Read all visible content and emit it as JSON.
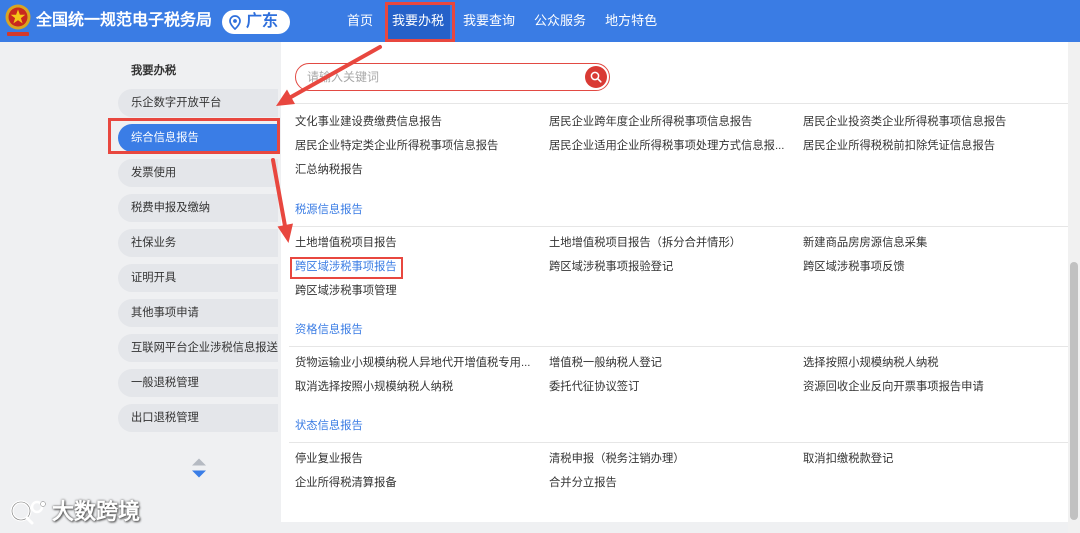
{
  "header": {
    "title": "全国统一规范电子税务局",
    "location": "广东",
    "nav": [
      {
        "label": "首页",
        "active": false
      },
      {
        "label": "我要办税",
        "active": true
      },
      {
        "label": "我要查询",
        "active": false
      },
      {
        "label": "公众服务",
        "active": false
      },
      {
        "label": "地方特色",
        "active": false
      }
    ]
  },
  "sidebar": {
    "heading": "我要办税",
    "selected_index": 1,
    "items": [
      "乐企数字开放平台",
      "综合信息报告",
      "发票使用",
      "税费申报及缴纳",
      "社保业务",
      "证明开具",
      "其他事项申请",
      "互联网平台企业涉税信息报送",
      "一般退税管理",
      "出口退税管理"
    ]
  },
  "search": {
    "placeholder": "请输入关键词"
  },
  "groups": [
    {
      "items": [
        "文化事业建设费缴费信息报告",
        "居民企业跨年度企业所得税事项信息报告",
        "居民企业投资类企业所得税事项信息报告",
        "居民企业特定类企业所得税事项信息报告",
        "居民企业适用企业所得税事项处理方式信息报...",
        "居民企业所得税税前扣除凭证信息报告",
        "汇总纳税报告"
      ]
    },
    {
      "title": "税源信息报告",
      "highlighted_index": 3,
      "items": [
        "土地增值税项目报告",
        "土地增值税项目报告（拆分合并情形）",
        "新建商品房房源信息采集",
        "跨区域涉税事项报告",
        "跨区域涉税事项报验登记",
        "跨区域涉税事项反馈",
        "跨区域涉税事项管理"
      ]
    },
    {
      "title": "资格信息报告",
      "items": [
        "货物运输业小规模纳税人异地代开增值税专用...",
        "增值税一般纳税人登记",
        "选择按照小规模纳税人纳税",
        "取消选择按照小规模纳税人纳税",
        "委托代征协议签订",
        "资源回收企业反向开票事项报告申请"
      ]
    },
    {
      "title": "状态信息报告",
      "items": [
        "停业复业报告",
        "清税申报（税务注销办理）",
        "取消扣缴税款登记",
        "企业所得税清算报备",
        "合并分立报告"
      ]
    }
  ],
  "watermark": "大数跨境",
  "colors": {
    "header_blue": "#3a7ce4",
    "nav_active": "#2561c9",
    "selected_blue": "#3a7de6",
    "annotation_red": "#e8473f",
    "search_red": "#d93a34",
    "link_text": "#333333"
  },
  "icons": {
    "logo": "tax-emblem-logo",
    "location": "location-pin-icon",
    "search": "search-icon",
    "scroll_up": "scroll-up-icon",
    "scroll_down": "scroll-down-icon",
    "watermark_logo": "watermark-logo-icon"
  }
}
